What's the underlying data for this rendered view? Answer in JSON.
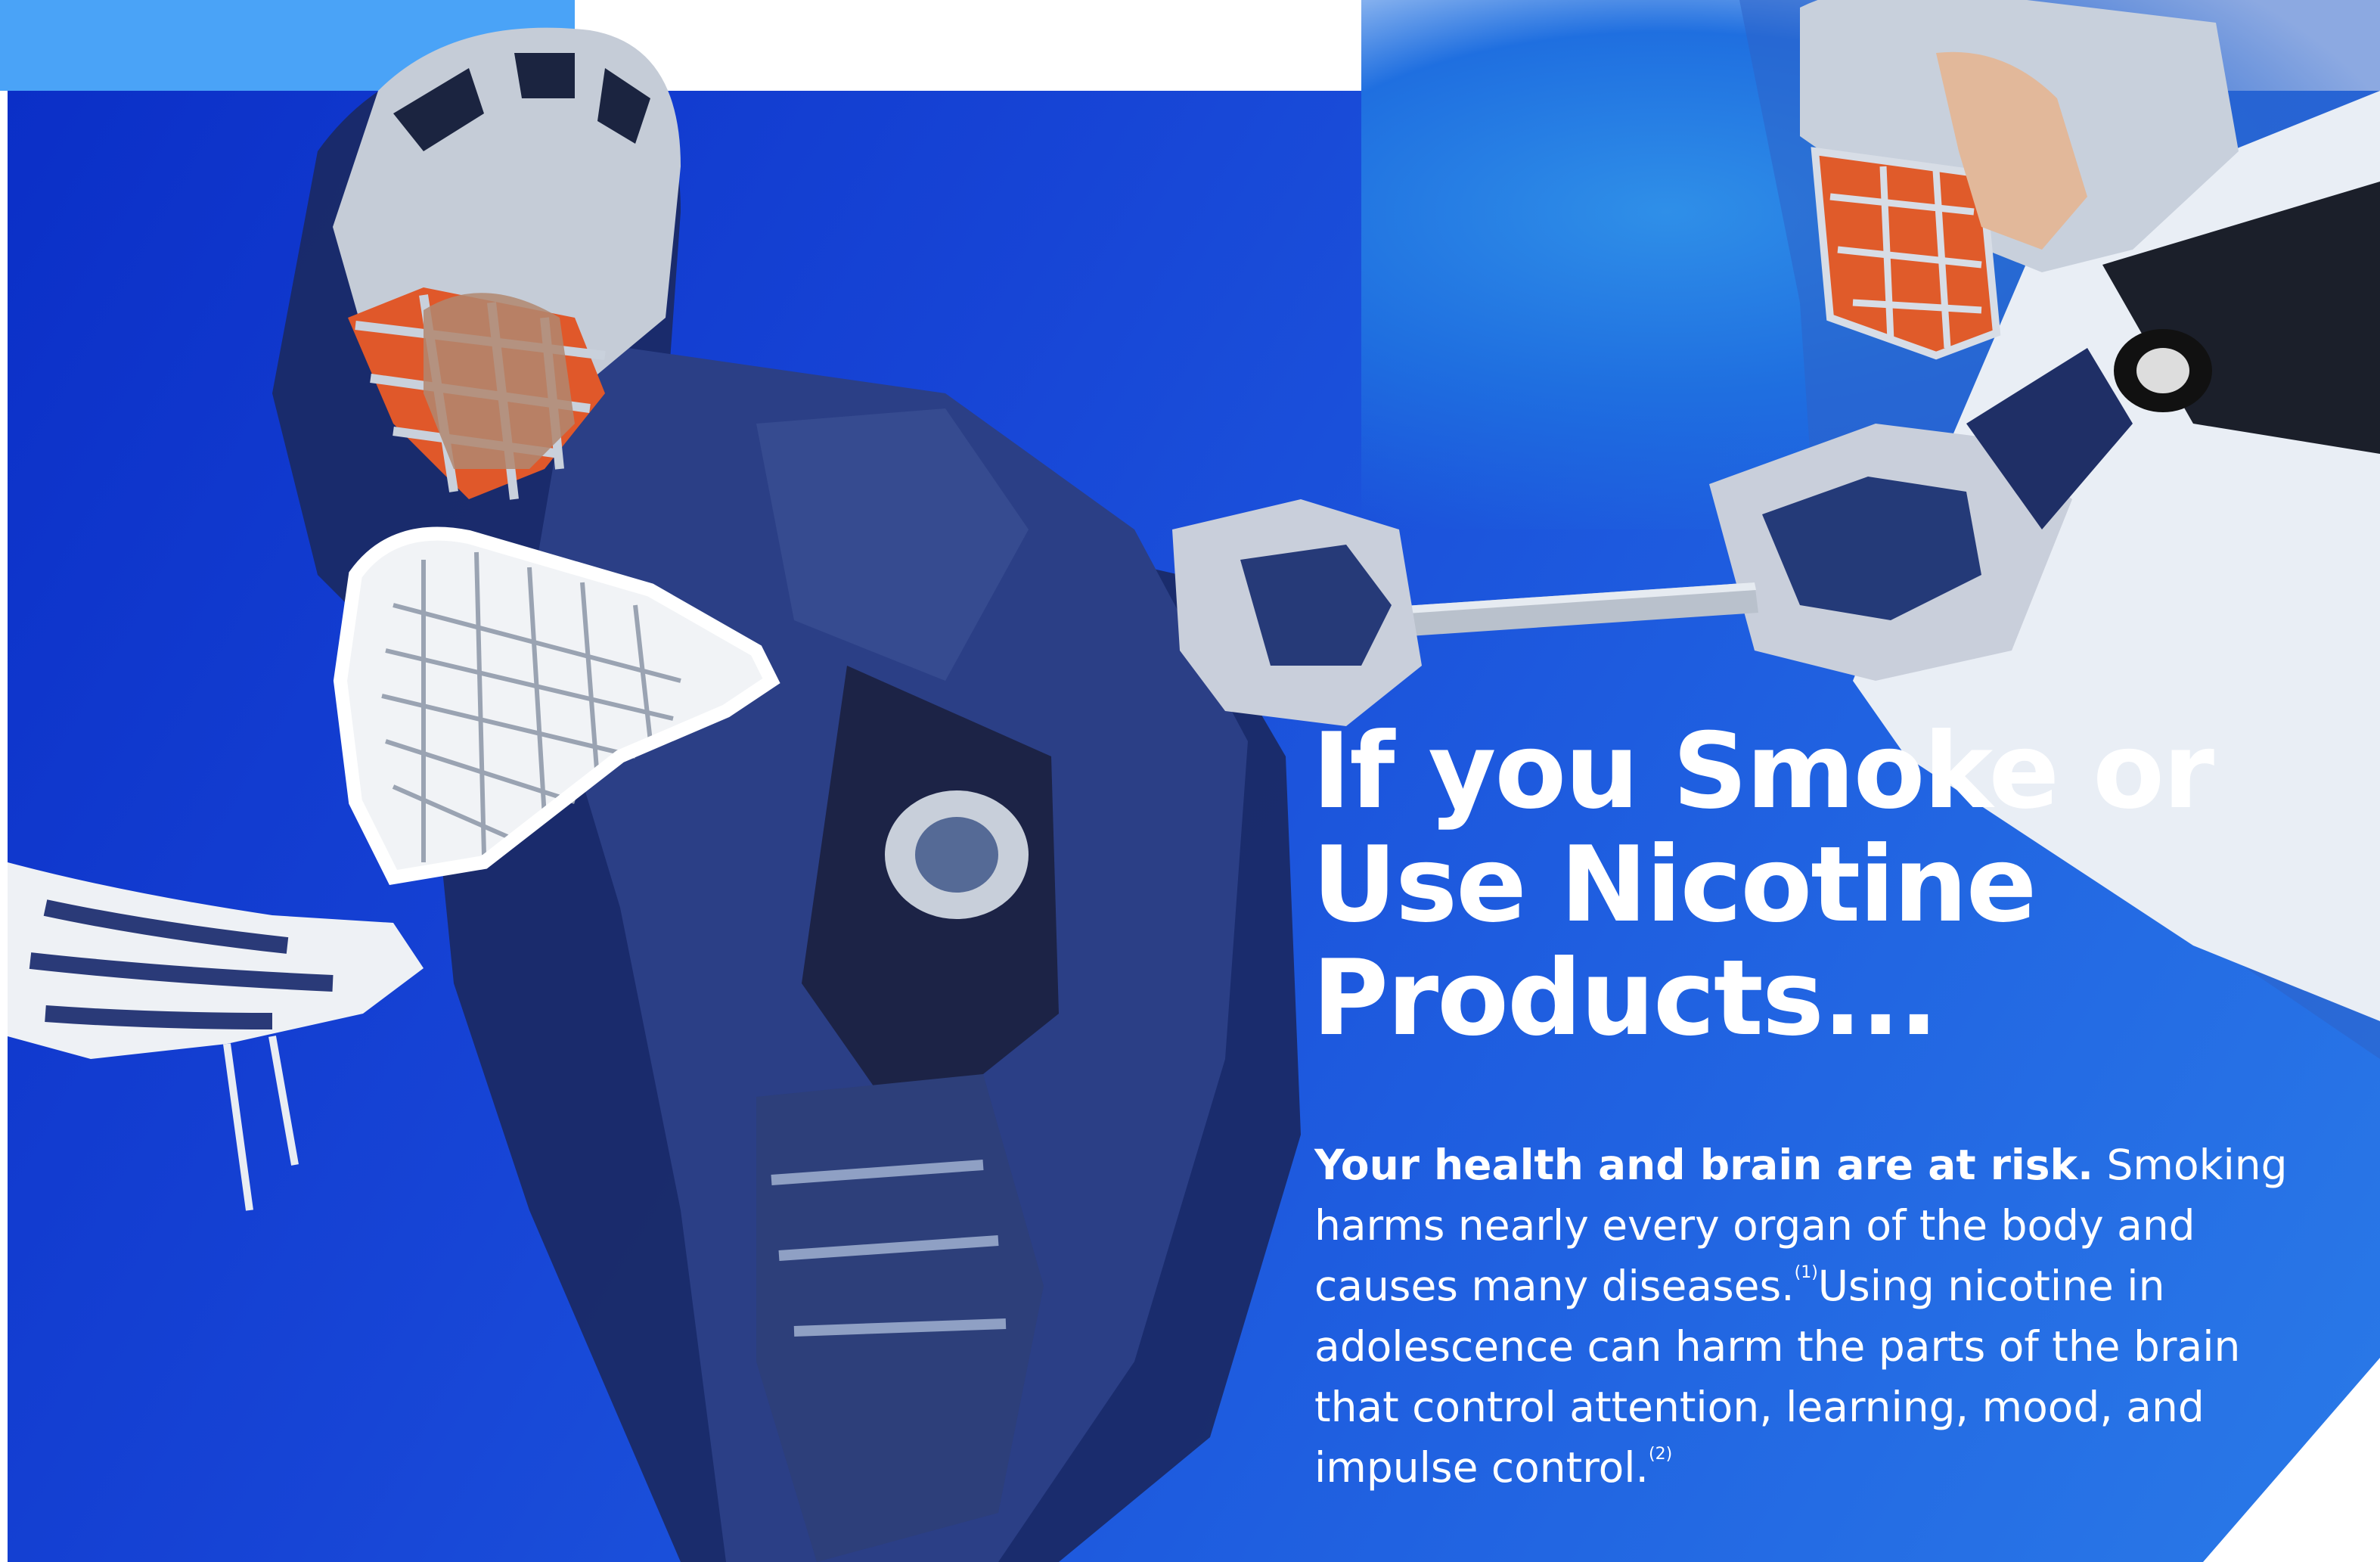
{
  "poster": {
    "headline_lines": [
      "If you Smoke or",
      "Use Nicotine",
      "Products..."
    ],
    "lead": "Your health and brain are at risk.",
    "sentence_1": " Smoking harms nearly every organ of  the body and causes many diseases.",
    "ref_1": "(1)",
    "sentence_2": "Using nicotine in adolescence can  harm the parts of the brain that control attention, learning, mood, and  impulse control.",
    "ref_2": "(2)"
  },
  "image": {
    "subject": "two lacrosse players in helmets with sticks",
    "player_left": "lacrosse-player-navy-jersey",
    "player_right": "lacrosse-player-white-jersey"
  },
  "colors": {
    "background_deep": "#0b2fc7",
    "background_light": "#2a7ae8",
    "tab_accent": "#4aa3f7",
    "text": "#ffffff"
  }
}
